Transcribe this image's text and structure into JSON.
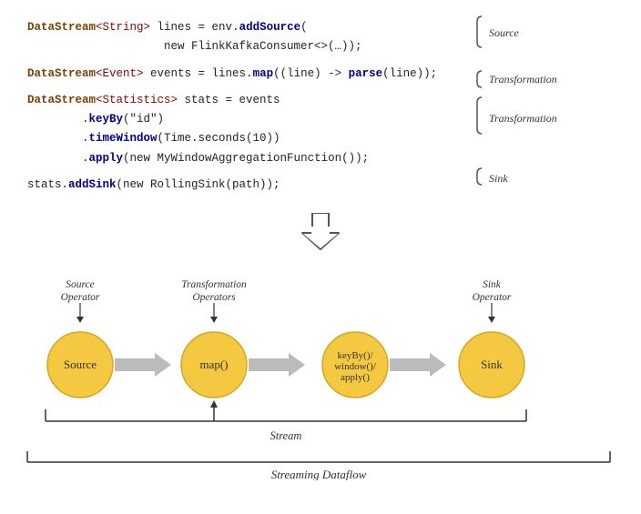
{
  "code": {
    "line1a": "DataStream",
    "line1b": "<String>",
    "line1c": " lines = env.",
    "line1d": "addSource",
    "line1e": "(",
    "line2a": "                    new FlinkKafkaConsumer<>(…));",
    "line3a": "DataStream",
    "line3b": "<Event>",
    "line3c": " events = lines.",
    "line3d": "map",
    "line3e": "((line) -> ",
    "line3f": "parse",
    "line3g": "(line));",
    "line4a": "DataStream",
    "line4b": "<Statistics>",
    "line4c": " stats = events",
    "line5a": "        .",
    "line5b": "keyBy",
    "line5c": "(\"id\")",
    "line6a": "        .",
    "line6b": "timeWindow",
    "line6c": "(Time.seconds(10))",
    "line7a": "        .",
    "line7b": "apply",
    "line7c": "(new MyWindowAggregationFunction());",
    "line8a": "stats.",
    "line8b": "addSink",
    "line8c": "(new RollingSink(path));"
  },
  "annotations": {
    "source": "Source",
    "transformation1": "Transformation",
    "transformation2": "Transformation",
    "sink": "Sink"
  },
  "diagram": {
    "nodes": [
      {
        "id": "source",
        "label": "Source",
        "top_annotation": "Source\nOperator"
      },
      {
        "id": "map",
        "label": "map()",
        "top_annotation": "Transformation\nOperators"
      },
      {
        "id": "keyby",
        "label": "keyBy()/\nwindow()/\napply()",
        "top_annotation": ""
      },
      {
        "id": "sink",
        "label": "Sink",
        "top_annotation": "Sink\nOperator"
      }
    ],
    "stream_label": "Stream",
    "streaming_dataflow_label": "Streaming Dataflow"
  }
}
